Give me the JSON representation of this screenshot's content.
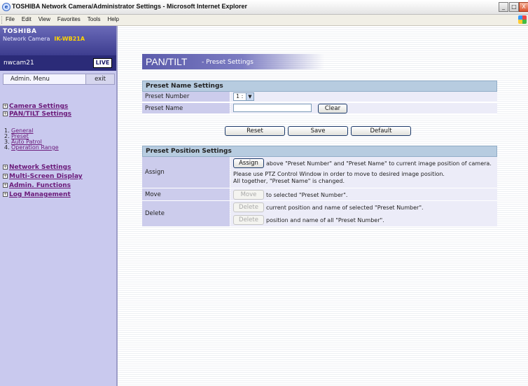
{
  "window": {
    "title": "TOSHIBA Network Camera/Administrator Settings - Microsoft Internet Explorer",
    "ie_icon": "ie-icon",
    "controls": {
      "minimize": "_",
      "maximize": "□",
      "close": "X"
    }
  },
  "menubar": {
    "items": [
      "File",
      "Edit",
      "View",
      "Favorites",
      "Tools",
      "Help"
    ]
  },
  "sidebar": {
    "brand": "TOSHIBA",
    "product": "Network Camera",
    "model": "IK-WB21A",
    "camera_name": "nwcam21",
    "live_label": "LIVE",
    "admin_menu_label": "Admin. Menu",
    "exit_label": "exit",
    "nav": {
      "camera_settings": "Camera Settings",
      "pantilt_settings": "PAN/TILT Settings",
      "sub": [
        {
          "num": "1.",
          "label": "General"
        },
        {
          "num": "2.",
          "label": "Preset"
        },
        {
          "num": "3.",
          "label": "Auto Patrol"
        },
        {
          "num": "4.",
          "label": "Operation Range"
        }
      ],
      "network_settings": "Network Settings",
      "multi_screen": "Multi-Screen Display",
      "admin_functions": "Admin. Functions",
      "log_management": "Log Management"
    }
  },
  "main": {
    "page_title": "PAN/TILT",
    "page_subtitle": "- Preset Settings",
    "preset_name": {
      "title": "Preset Name Settings",
      "number_label": "Preset Number",
      "number_value": "1 :",
      "name_label": "Preset Name",
      "name_value": "",
      "clear_label": "Clear"
    },
    "buttons": {
      "reset": "Reset",
      "save": "Save",
      "default": "Default"
    },
    "preset_position": {
      "title": "Preset Position Settings",
      "assign_label": "Assign",
      "assign_button": "Assign",
      "assign_text": "above \"Preset Number\" and \"Preset Name\" to current image position of camera.",
      "assign_note1": "Please use PTZ Control Window in order to move to desired image position.",
      "assign_note2": "All together, \"Preset Name\" is changed.",
      "move_label": "Move",
      "move_button": "Move",
      "move_text": "to selected \"Preset Number\".",
      "delete_label": "Delete",
      "delete_button": "Delete",
      "delete_text1": "current position and name of selected \"Preset Number\".",
      "delete_text2": "position and name of all \"Preset Number\"."
    }
  }
}
